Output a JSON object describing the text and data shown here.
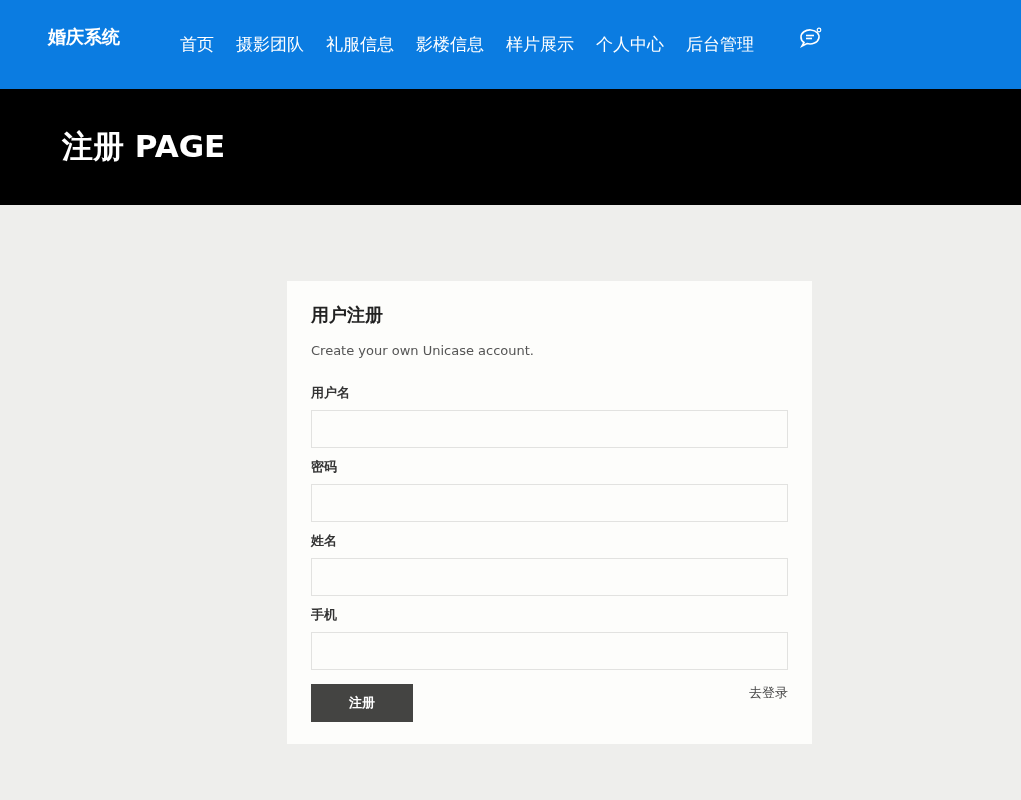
{
  "brand": "婚庆系统",
  "nav": [
    {
      "label": "首页"
    },
    {
      "label": "摄影团队"
    },
    {
      "label": "礼服信息"
    },
    {
      "label": "影楼信息"
    },
    {
      "label": "样片展示"
    },
    {
      "label": "个人中心"
    },
    {
      "label": "后台管理"
    }
  ],
  "banner": {
    "title": "注册 PAGE"
  },
  "form": {
    "title": "用户注册",
    "subtitle": "Create your own Unicase account.",
    "fields": [
      {
        "label": "用户名"
      },
      {
        "label": "密码"
      },
      {
        "label": "姓名"
      },
      {
        "label": "手机"
      }
    ],
    "submit": "注册",
    "login_link": "去登录"
  }
}
